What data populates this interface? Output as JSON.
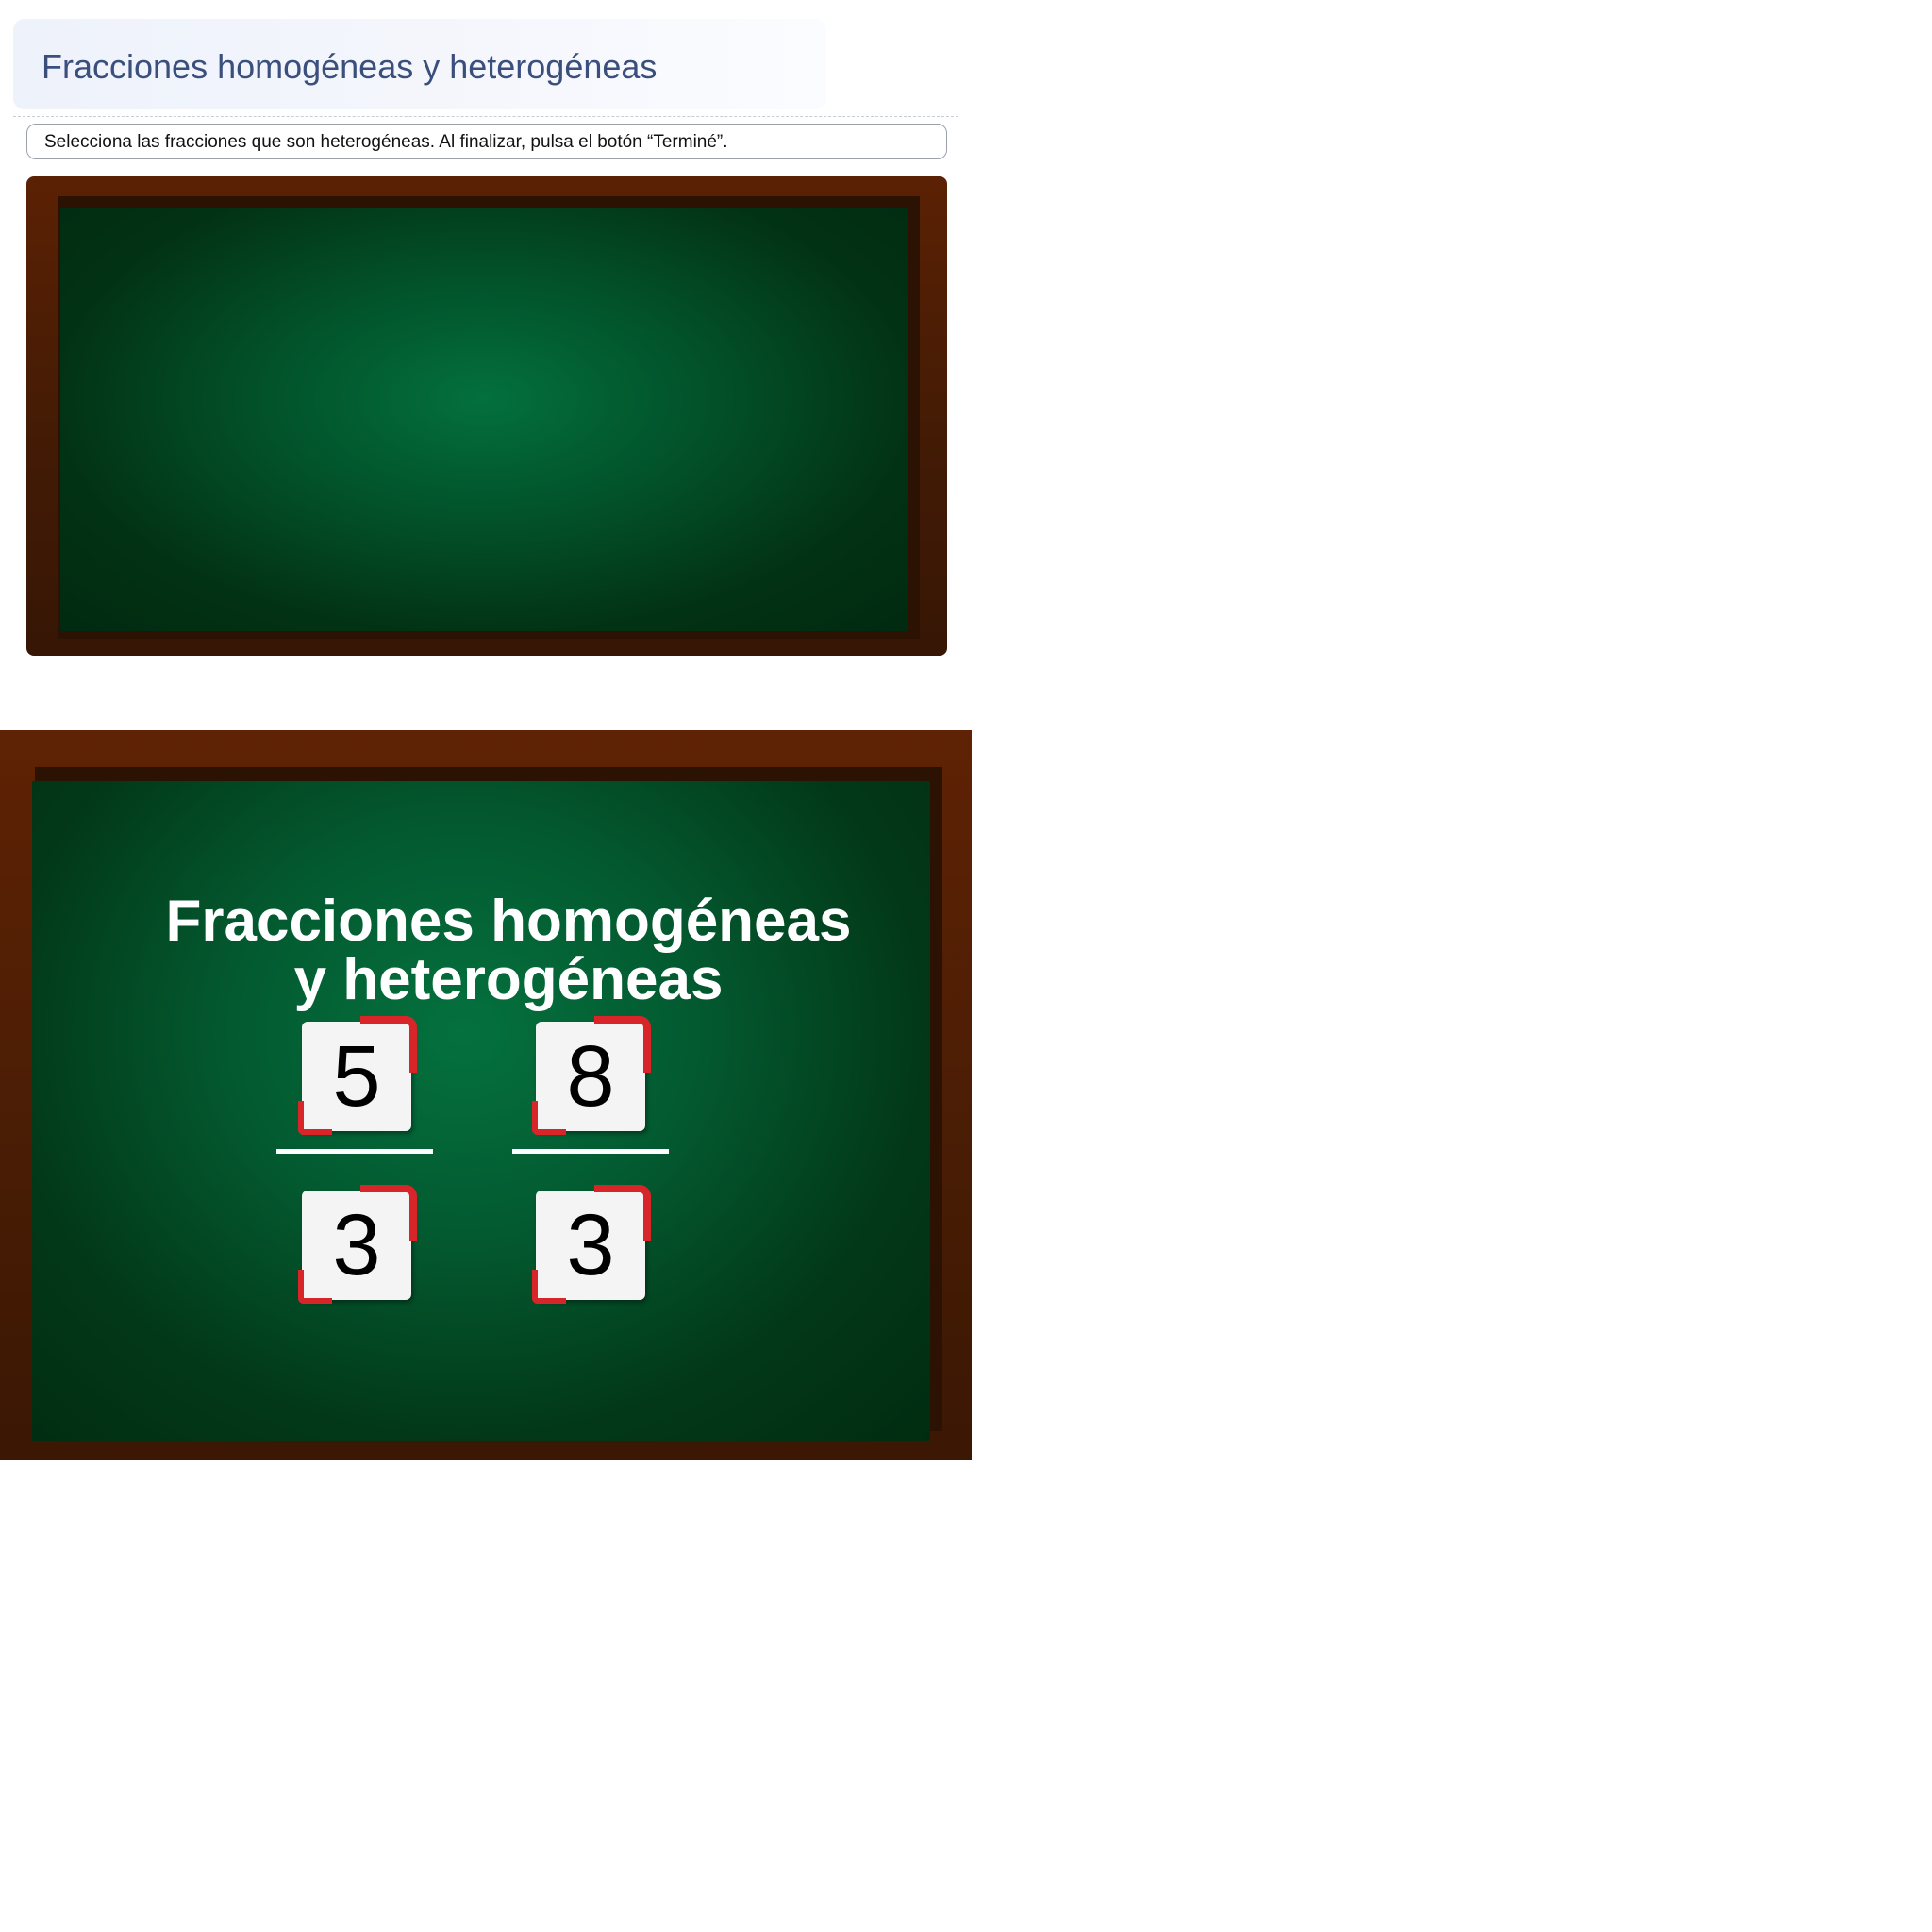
{
  "header": {
    "title": "Fracciones homogéneas y heterogéneas"
  },
  "instructions": {
    "text": "Selecciona las fracciones que son heterogéneas. Al finalizar, pulsa el botón “Terminé”."
  },
  "slide": {
    "title_line1": "Fracciones homogéneas",
    "title_line2": "y heterogéneas",
    "fractions": [
      {
        "numerator": "5",
        "denominator": "3"
      },
      {
        "numerator": "8",
        "denominator": "3"
      }
    ]
  },
  "colors": {
    "header_text": "#3b4f7d",
    "chalkboard_green": "#03703d",
    "frame_brown": "#5b2104",
    "tile_corner_red": "#d8252a"
  }
}
